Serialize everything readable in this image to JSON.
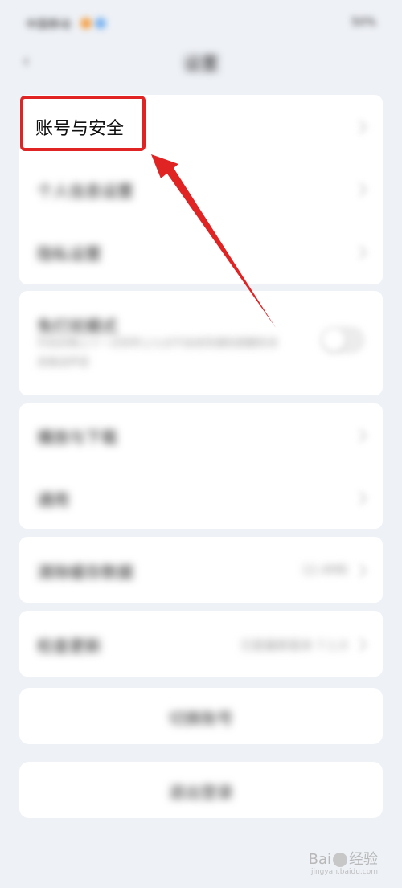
{
  "status_bar": {
    "left_text": "中国移动",
    "right_text": "50%"
  },
  "header": {
    "title": "设置",
    "back_icon": "chevron-left-icon"
  },
  "section1": {
    "items": [
      {
        "label": "账号与安全"
      },
      {
        "label": "个人信息设置"
      },
      {
        "label": "隐私设置"
      }
    ]
  },
  "section2": {
    "label": "免打扰模式",
    "description": "开启后晚上十一点到早上七点不会收到通知提醒和消息推送声音"
  },
  "section3": {
    "items": [
      {
        "label": "播放与下载"
      },
      {
        "label": "通用"
      }
    ]
  },
  "section4": {
    "label": "清除缓存数据",
    "value": "12.4MB"
  },
  "section5": {
    "label": "检查更新",
    "value": "已是最新版本 7.1.0"
  },
  "buttons": {
    "switch_account": "切换账号",
    "logout": "退出登录"
  },
  "watermark": {
    "brand": "Bai",
    "brand_suffix": "经验",
    "sub": "jingyan.baidu.com"
  },
  "colors": {
    "highlight": "#e02424",
    "page_bg": "#eef1f6"
  }
}
